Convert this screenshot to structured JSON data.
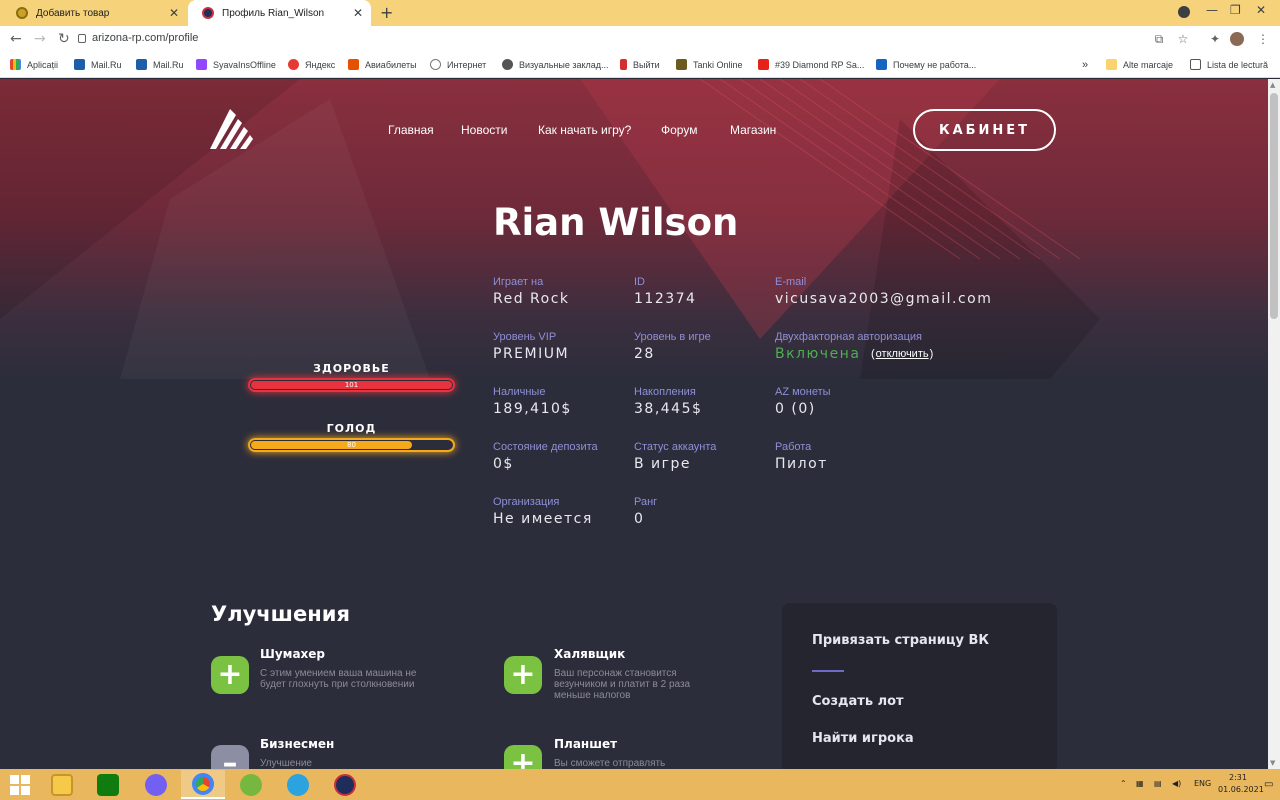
{
  "browser": {
    "tabs": [
      {
        "title": "Добавить товар",
        "active": false
      },
      {
        "title": "Профиль Rian_Wilson",
        "active": true
      }
    ],
    "url": "arizona-rp.com/profile",
    "bookmarks": [
      "Aplicații",
      "Mail.Ru",
      "Mail.Ru",
      "SyavaInsOffline",
      "Яндекс",
      "Авиабилеты",
      "Интернет",
      "Визуальные заклад...",
      "Выйти",
      "Tanki Online",
      "#39 Diamond RP Sa...",
      "Почему не работа..."
    ],
    "bookmarks_right": [
      "Alte marcaje",
      "Lista de lectură"
    ],
    "overflow": "»"
  },
  "site": {
    "nav": [
      "Главная",
      "Новости",
      "Как начать игру?",
      "Форум",
      "Магазин"
    ],
    "cabinet_label": "КАБИНЕТ"
  },
  "profile": {
    "name": "Rian Wilson",
    "fields": [
      {
        "label": "Играет на",
        "value": "Red Rock"
      },
      {
        "label": "ID",
        "value": "112374"
      },
      {
        "label": "E-mail",
        "value": "vicusava2003@gmail.com"
      },
      {
        "label": "Уровень VIP",
        "value": "PREMIUM"
      },
      {
        "label": "Уровень в игре",
        "value": "28"
      },
      {
        "label": "Двухфакторная авторизация",
        "value": "Включена"
      },
      {
        "label": "Наличные",
        "value": "189,410$"
      },
      {
        "label": "Накопления",
        "value": "38,445$"
      },
      {
        "label": "AZ монеты",
        "value": "0 (0)"
      },
      {
        "label": "Состояние депозита",
        "value": "0$"
      },
      {
        "label": "Статус аккаунта",
        "value": "В игре"
      },
      {
        "label": "Работа",
        "value": "Пилот"
      },
      {
        "label": "Организация",
        "value": "Не имеется"
      },
      {
        "label": "Ранг",
        "value": "0"
      }
    ],
    "twofa_disable_open": "(",
    "twofa_disable": "отключить",
    "twofa_disable_close": ")"
  },
  "stats": {
    "health": {
      "label": "ЗДОРОВЬЕ",
      "value": "101",
      "fraction": 1.0,
      "color": "#e8333f"
    },
    "hunger": {
      "label": "ГОЛОД",
      "value": "80",
      "fraction": 0.8,
      "color": "#f5a91b"
    }
  },
  "upgrades": {
    "title": "Улучшения",
    "items": [
      {
        "name": "Шумахер",
        "desc": "С этим умением ваша машина не будет глохнуть при столкновении",
        "icon": "plus-icon",
        "state": "available"
      },
      {
        "name": "Халявщик",
        "desc": "Ваш персонаж становится везунчиком и платит в 2 раза меньше налогов",
        "icon": "plus-icon",
        "state": "available"
      },
      {
        "name": "Бизнесмен",
        "desc": "Улучшение",
        "icon": "minus-icon",
        "state": "owned"
      },
      {
        "name": "Планшет",
        "desc": "Вы сможете отправлять",
        "icon": "plus-icon",
        "state": "available"
      }
    ]
  },
  "panel": {
    "items": [
      "Привязать страницу ВК",
      "Создать лот",
      "Найти игрока"
    ]
  },
  "taskbar": {
    "lang": "ENG",
    "time": "2:31",
    "date": "01.06.2021"
  },
  "colors": {
    "accent": "#8f8fd6",
    "green": "#4caf50",
    "upgrade_green": "#7cc242",
    "upgrade_grey": "#8c8ea3"
  }
}
